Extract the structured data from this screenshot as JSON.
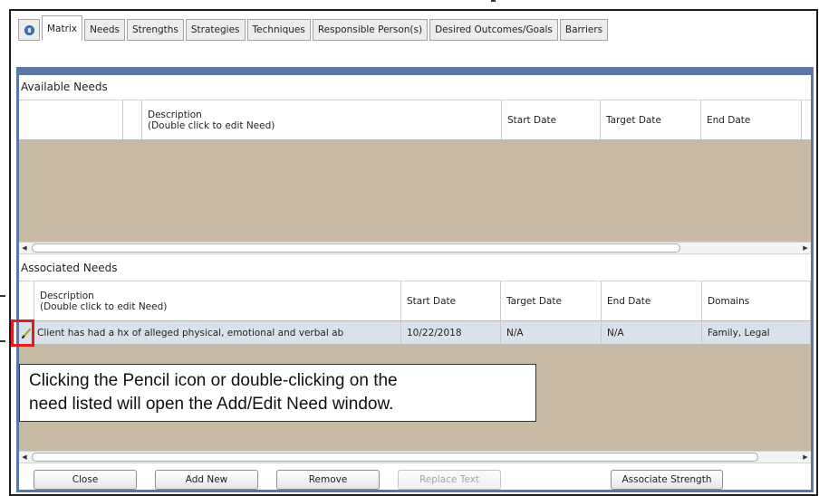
{
  "tabs": [
    {
      "label": "Matrix",
      "active": true
    },
    {
      "label": "Needs",
      "active": false
    },
    {
      "label": "Strengths",
      "active": false
    },
    {
      "label": "Strategies",
      "active": false
    },
    {
      "label": "Techniques",
      "active": false
    },
    {
      "label": "Responsible Person(s)",
      "active": false
    },
    {
      "label": "Desired Outcomes/Goals",
      "active": false
    },
    {
      "label": "Barriers",
      "active": false
    }
  ],
  "tab_icon": "info-icon",
  "available_needs": {
    "title": "Available Needs",
    "columns": {
      "description": {
        "line1": "Description",
        "line2": "(Double click to edit Need)"
      },
      "start_date": "Start Date",
      "target_date": "Target Date",
      "end_date": "End Date"
    }
  },
  "associated_needs": {
    "title": "Associated Needs",
    "columns": {
      "description": {
        "line1": "Description",
        "line2": "(Double click to edit Need)"
      },
      "start_date": "Start Date",
      "target_date": "Target Date",
      "end_date": "End Date",
      "domains": "Domains"
    },
    "rows": [
      {
        "description": "Client has had a hx of alleged physical, emotional and verbal ab",
        "start_date": "10/22/2018",
        "target_date": "N/A",
        "end_date": "N/A",
        "domains": "Family, Legal"
      }
    ]
  },
  "callout": {
    "line1": "Clicking the Pencil icon or double-clicking on the",
    "line2": "need listed will open the Add/Edit Need window."
  },
  "buttons": {
    "close": "Close",
    "add_new": "Add New",
    "remove": "Remove",
    "replace_text": "Replace Text",
    "associate_strength": "Associate Strength"
  },
  "colors": {
    "grid_empty_area": "#c8bba5",
    "selected_row": "#d9e1ea",
    "panel_border": "#5b78a4",
    "highlight_box": "#e41c1c"
  }
}
